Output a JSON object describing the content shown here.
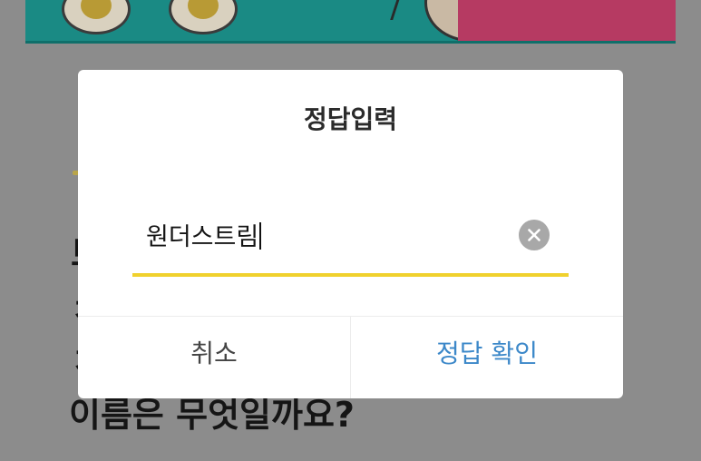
{
  "background": {
    "question_line_partial_1": "브",
    "question_line_partial_2": "ㅊ",
    "question_line_partial_3": "ㅈ",
    "question_line": "이름은 무엇일까요?"
  },
  "dialog": {
    "title": "정답입력",
    "input": {
      "value": "원더스트림"
    },
    "clear_icon": "close-circle-icon",
    "cancel_label": "취소",
    "confirm_label": "정답 확인"
  },
  "colors": {
    "input_underline": "#f0d12d",
    "confirm_text": "#3c88c9",
    "clear_button": "#a8a8a8"
  }
}
